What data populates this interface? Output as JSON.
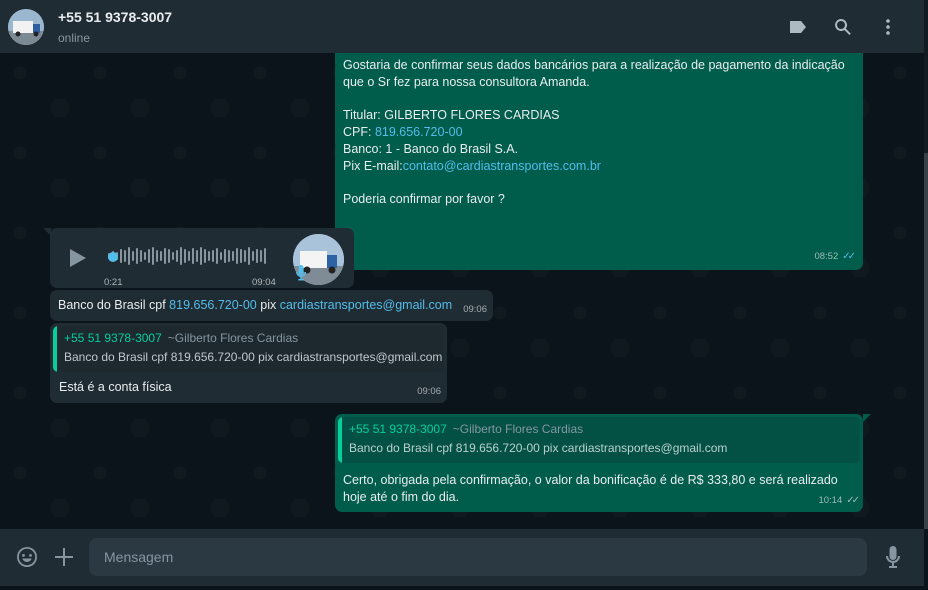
{
  "header": {
    "contact_name": "+55 51 9378-3007",
    "status": "online"
  },
  "messages": {
    "m1": {
      "lines": [
        "Gostaria de confirmar seus dados bancários para a realização de pagamento da indicação",
        "que o Sr fez para nossa consultora Amanda."
      ],
      "holder": "Titular: GILBERTO FLORES CARDIAS",
      "cpf_label": "CPF: ",
      "cpf_value": "819.656.720-00",
      "bank": "Banco: 1 - Banco do Brasil S.A.",
      "pix_label": "Pix E-mail:",
      "pix_value": "contato@cardiastransportes.com.br",
      "question": "Poderia confirmar por favor ?",
      "time": "08:52"
    },
    "audio": {
      "duration": "0:21",
      "time": "09:04"
    },
    "m2": {
      "prefix": "Banco do Brasil  cpf ",
      "cpf": "819.656.720-00",
      "mid": " pix ",
      "email": "cardiastransportes@gmail.com",
      "time": "09:06"
    },
    "m3": {
      "quote_author": "+55 51 9378-3007",
      "quote_push": "~Gilberto Flores Cardias",
      "quote_text": "Banco do Brasil  cpf 819.656.720-00 pix cardiastransportes@gmail.com",
      "text": "Está é a conta física",
      "time": "09:06"
    },
    "m4": {
      "quote_author": "+55 51 9378-3007",
      "quote_push": "~Gilberto Flores Cardias",
      "quote_text": "Banco do Brasil  cpf 819.656.720-00 pix cardiastransportes@gmail.com",
      "text_line1": "Certo, obrigada pela confirmação, o valor da bonificação é de R$ 333,80 e será realizado",
      "text_line2": "hoje até o fim do dia.",
      "time": "10:14"
    }
  },
  "composer": {
    "placeholder": "Mensagem"
  },
  "colors": {
    "outgoing_bubble": "#005c4b",
    "incoming_bubble": "#202c33",
    "link": "#53bdeb",
    "quote_accent": "#06cf9c"
  },
  "icons": {
    "label": "label-icon",
    "search": "search-icon",
    "menu": "menu-icon",
    "emoji": "emoji-icon",
    "attach": "plus-icon",
    "mic": "mic-icon"
  }
}
